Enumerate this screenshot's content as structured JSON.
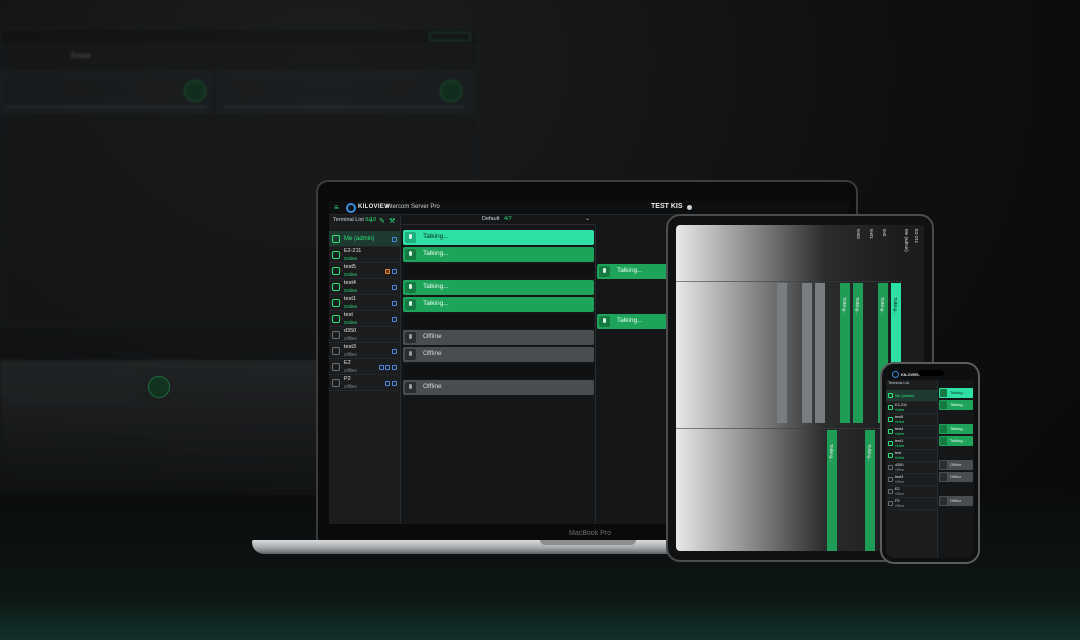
{
  "background": {
    "window_title": "Бонж"
  },
  "laptop": {
    "brand": "MacBook Pro",
    "app": {
      "logo": "KILOVIEW",
      "name": "Intercom Server Pro",
      "session": "TEST KIS",
      "menu_icon": "menu-icon"
    },
    "terminal_list": {
      "title": "Terminal List",
      "count": "6/10",
      "items": [
        {
          "name": "Me (admin)",
          "status": "",
          "selected": true
        },
        {
          "name": "E2-211",
          "status": "Online"
        },
        {
          "name": "test5",
          "status": "Online"
        },
        {
          "name": "test4",
          "status": "Online"
        },
        {
          "name": "test1",
          "status": "Online"
        },
        {
          "name": "test",
          "status": "Online"
        },
        {
          "name": "d350",
          "status": "Offline"
        },
        {
          "name": "test3",
          "status": "Offline"
        },
        {
          "name": "E2",
          "status": "Offline"
        },
        {
          "name": "P2",
          "status": "Offline"
        }
      ]
    },
    "group": {
      "label": "Default",
      "count": "4/7"
    },
    "channels": {
      "talking": "Talking...",
      "offline": "Offline"
    }
  },
  "tablet": {
    "vertical_labels": [
      "test4",
      "test1",
      "test",
      "E2-211",
      "Me (admin)",
      "Talking..."
    ]
  },
  "phone": {
    "logo": "KILOVIEW",
    "app": "Intercom Server Pro",
    "terminal_list": {
      "title": "Terminal List",
      "items": [
        {
          "name": "Me (admin)",
          "status": "",
          "selected": true
        },
        {
          "name": "E2-211",
          "status": "Online"
        },
        {
          "name": "test5",
          "status": "Online"
        },
        {
          "name": "test4",
          "status": "Online"
        },
        {
          "name": "test1",
          "status": "Online"
        },
        {
          "name": "test",
          "status": "Online"
        },
        {
          "name": "d350",
          "status": "Offline"
        },
        {
          "name": "test3",
          "status": "Offline"
        },
        {
          "name": "E2",
          "status": "Offline"
        },
        {
          "name": "P2",
          "status": "Offline"
        }
      ]
    },
    "channels": {
      "talking": "Talking...",
      "offline": "Offline"
    }
  },
  "colors": {
    "accent": "#2ee27a",
    "talking": "#1ea35a",
    "talking_selected": "#2fe0a6",
    "offline": "#4a4d50",
    "brand_blue": "#3a8ddc"
  }
}
